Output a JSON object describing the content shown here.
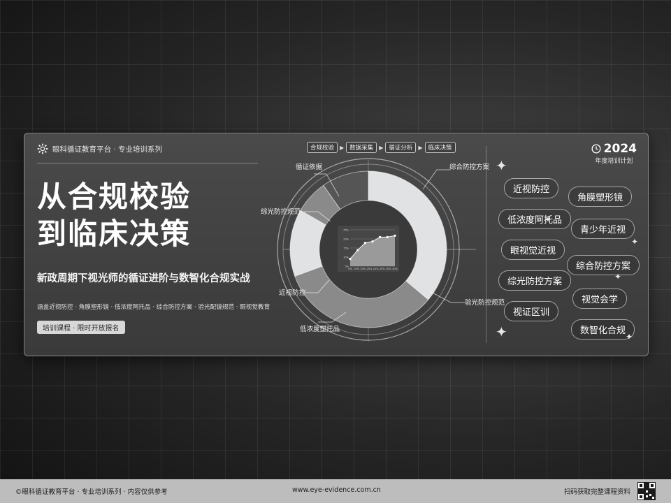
{
  "header": {
    "brand": "眼科循证教育平台 · 专业培训系列",
    "title_line1": "从合规校验",
    "title_line2": "到临床决策",
    "subtitle": "新政周期下视光师的循证进阶与数智化合规实战",
    "scope": "涵盖近视防控 · 角膜塑形镜 · 低浓度阿托品 · 综合防控方案 · 验光配镜规范 · 眼视觉教育",
    "tag": "培训课程 · 限时开放报名"
  },
  "flow": [
    "合规校验",
    "数据采集",
    "循证分析",
    "临床决策"
  ],
  "ring_labels": {
    "top_left": "循证依据",
    "upper_left": "综光防控规范",
    "lower_left": "近视防控",
    "bottom": "低浓度塑托品",
    "top_right": "综合防控方案",
    "lower_right": "验光防控规范"
  },
  "chart_data": {
    "type": "line",
    "x": [
      "0%",
      "20%",
      "20%",
      "20%",
      "20%",
      "25%",
      "20%",
      "20%"
    ],
    "values": [
      5,
      11,
      16,
      17,
      20,
      20,
      21
    ],
    "ylim": [
      0,
      25
    ],
    "yticks": [
      "25%",
      "20%",
      "15%",
      "10%",
      "5%"
    ],
    "grid": true
  },
  "right_panel": {
    "year": "2024",
    "year_sub": "年度培训计划",
    "pills": [
      "近视防控",
      "角膜塑形镜",
      "低浓度阿托品",
      "青少年近视",
      "眼视觉近视",
      "综合防控方案",
      "综光防控方案",
      "视觉会学",
      "视证区训",
      "数智化合规"
    ]
  },
  "footer": {
    "left": "©眼科循证教育平台 · 专业培训系列 · 内容仅供参考",
    "center": "www.eye-evidence.com.cn",
    "right": "扫码获取完整课程资料"
  },
  "colors": {
    "panel": "#3f3f3f",
    "ring_light": "#e0e2e4",
    "ring_mid": "#8a8a8a",
    "ring_dark": "#555555",
    "footer": "#bdbdbd"
  }
}
